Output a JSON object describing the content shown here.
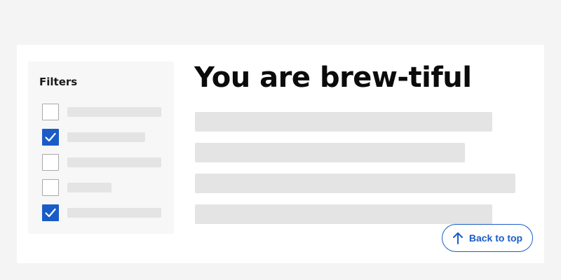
{
  "filters": {
    "title": "Filters",
    "items": [
      {
        "checked": false
      },
      {
        "checked": true
      },
      {
        "checked": false
      },
      {
        "checked": false
      },
      {
        "checked": true
      }
    ]
  },
  "main": {
    "heading": "You are brew-tiful"
  },
  "back_to_top": {
    "label": "Back to top",
    "icon": "arrow-up-icon"
  },
  "colors": {
    "accent": "#1a5cc7",
    "placeholder": "#e4e4e4",
    "page_background": "#f4f4f4"
  }
}
